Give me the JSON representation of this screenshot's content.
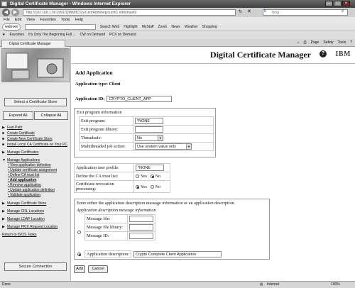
{
  "browser": {
    "window_title": "Digital Certificate Manager - Windows Internet Explorer",
    "url": "http://192.168.1.56:2001/QIBM/ICSS/Cert/Admin/qycucm1.ndm/main0",
    "search_placeholder": "Bing",
    "menu": [
      "File",
      "Edit",
      "View",
      "Favorites",
      "Tools",
      "Help"
    ],
    "webroot_label": "webroot",
    "webroot_items": [
      "Search Web",
      "Highlight",
      "MyStuff",
      "Zoom",
      "News",
      "Weather",
      "Shopping"
    ],
    "favorites_label": "Favorites",
    "favorites_items": [
      "It's Only The Beginning Full ...",
      "CW on Demand",
      "PCX on Demand"
    ],
    "tab_title": "Digital Certificate Manager",
    "tab_tools": [
      "Page",
      "Safety",
      "Tools"
    ],
    "status_left": "Done",
    "status_zone": "Internet",
    "zoom": "100%"
  },
  "header": {
    "title": "Digital Certificate Manager",
    "ibm": "IBM"
  },
  "sidebar": {
    "select_store": "Select a Certificate Store",
    "expand_all": "Expand All",
    "collapse_all": "Collapse All",
    "nav": [
      {
        "label": "Fast Path",
        "marker": "▶"
      },
      {
        "label": "Create Certificate",
        "marker": "■"
      },
      {
        "label": "Create New Certificate Store",
        "marker": "■"
      },
      {
        "label": "Install Local CA Certificate on Your PC",
        "marker": "■"
      },
      {
        "label": "Manage Certificates",
        "marker": "▶"
      },
      {
        "label": "Manage Applications",
        "marker": "▼"
      }
    ],
    "sub_nav": [
      {
        "label": "View application definition"
      },
      {
        "label": "Update certificate assignment"
      },
      {
        "label": "Define CA trust list"
      },
      {
        "label": "Add application"
      },
      {
        "label": "Remove application"
      },
      {
        "label": "Update application definition"
      },
      {
        "label": "Validate application"
      }
    ],
    "nav2": [
      {
        "label": "Manage Certificate Store",
        "marker": "▶"
      },
      {
        "label": "Manage CRL Locations",
        "marker": "▶"
      },
      {
        "label": "Manage LDAP Location",
        "marker": "▶"
      },
      {
        "label": "Manage PKIX Request Location",
        "marker": "▶"
      }
    ],
    "return_link": "Return to i5/OS Tasks",
    "secure": "Secure Connection"
  },
  "main": {
    "heading": "Add Application",
    "app_type": "Application type:  Client",
    "app_id_label": "Application ID:",
    "app_id_value": "CRYPTO_CLIENT_APP",
    "exit_title": "Exit program information",
    "exit_program_label": "Exit program:",
    "exit_program_value": "*NONE",
    "exit_library_label": "Exit program library:",
    "exit_library_value": "",
    "threadsafe_label": "Threadsafe:",
    "threadsafe_value": "No",
    "mt_label": "Multithreaded job action:",
    "mt_value": "Use system value only",
    "profile_label": "Application user profile:",
    "profile_value": "*NONE",
    "ca_trust_label": "Define the CA trust list:",
    "revocation_label": "Certificate revocation processing:",
    "yes": "Yes",
    "no": "No",
    "desc_instr": "Enter either the application description message information or an application description.",
    "desc_msg_title": "Application description message information",
    "msg_file_label": "Message file:",
    "msg_lib_label": "Message file library:",
    "msg_id_label": "Message ID:",
    "app_desc_label": "Application description:",
    "app_desc_value": "Crypto Complete Client Application",
    "add_button": "Add",
    "cancel_button": "Cancel"
  }
}
